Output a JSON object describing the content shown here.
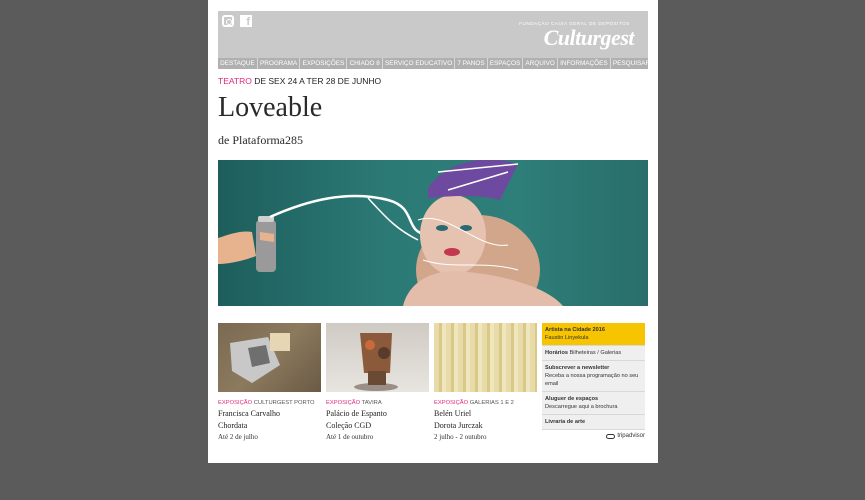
{
  "header": {
    "foundation": "FUNDAÇÃO CAIXA GERAL DE DEPÓSITOS",
    "logo": "Culturgest",
    "social": [
      "instagram-icon",
      "facebook-icon"
    ]
  },
  "nav": [
    "DESTAQUE",
    "PROGRAMA",
    "EXPOSIÇÕES",
    "CHIADO 8",
    "SERVIÇO EDUCATIVO",
    "7 PANOS",
    "ESPAÇOS",
    "ARQUIVO",
    "INFORMAÇÕES",
    "PESQUISAR"
  ],
  "event": {
    "category": "TEATRO",
    "dates": " DE SEX 24 A TER 28 DE JUNHO",
    "title": "Loveable",
    "subtitle": "de Plataforma285"
  },
  "thumbs": [
    {
      "category": "EXPOSIÇÃO",
      "place": " CULTURGEST PORTO",
      "line1": "Francisca Carvalho",
      "line2": "Chordata",
      "line3": "Até 2 de julho"
    },
    {
      "category": "EXPOSIÇÃO",
      "place": " TAVIRA",
      "line1": "Palácio de Espanto",
      "line2": "Coleção CGD",
      "line3": "Até 1 de outubro"
    },
    {
      "category": "EXPOSIÇÃO",
      "place": " GALERIAS 1 E 2",
      "line1": "Belén Uriel",
      "line2": "Dorota Jurczak",
      "line3": "2 julho - 2 outubro"
    }
  ],
  "sidebar": {
    "artist_title": "Artista na Cidade 2016",
    "artist_name": "Faustin Linyekula",
    "horarios_title": "Horários",
    "horarios_rest": " Bilheteiras / Galerias",
    "newsletter_title": "Subscrever a newsletter",
    "newsletter_text": "Receba a nossa programação no seu email",
    "aluguer_title": "Aluguer de espaços",
    "aluguer_text": "Descarregue aqui a brochura",
    "livraria": "Livraria de arte",
    "tripadvisor": "tripadvisor"
  },
  "colors": {
    "accent": "#e0287e",
    "yellow": "#f6c400",
    "background": "#5b5b5b"
  }
}
